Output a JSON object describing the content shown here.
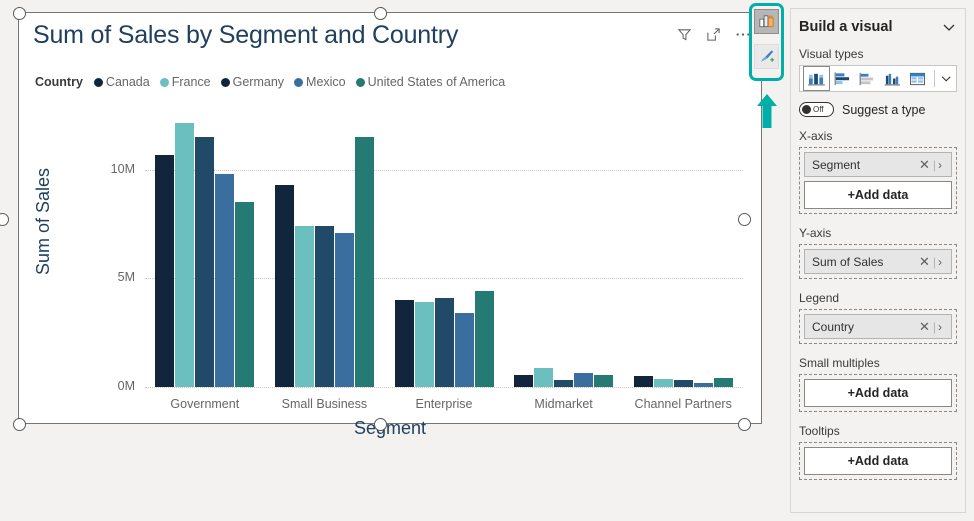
{
  "visual": {
    "title": "Sum of Sales by Segment and Country",
    "tools": {
      "filter": "filter-icon",
      "focus": "focus-mode-icon",
      "more": "more-options-icon"
    }
  },
  "chart_data": {
    "type": "bar",
    "title": "Sum of Sales by Segment and Country",
    "xlabel": "Segment",
    "ylabel": "Sum of Sales",
    "categories": [
      "Government",
      "Small Business",
      "Enterprise",
      "Midmarket",
      "Channel Partners"
    ],
    "ylim": [
      0,
      12800000
    ],
    "yticks": [
      {
        "label": "0M",
        "value": 0
      },
      {
        "label": "5M",
        "value": 5000000
      },
      {
        "label": "10M",
        "value": 10000000
      }
    ],
    "grid": true,
    "legend_title": "Country",
    "legend_position": "top",
    "series": [
      {
        "name": "Canada",
        "color": "#11263c",
        "values": [
          10700000,
          9300000,
          4000000,
          560000,
          500000
        ]
      },
      {
        "name": "France",
        "color": "#6cbfbf",
        "values": [
          12150000,
          7400000,
          3900000,
          860000,
          350000
        ]
      },
      {
        "name": "Germany",
        "color": "#214a69",
        "values": [
          11500000,
          7400000,
          4100000,
          300000,
          310000
        ]
      },
      {
        "name": "Mexico",
        "color": "#3a6e9e",
        "values": [
          9800000,
          7100000,
          3400000,
          660000,
          200000
        ]
      },
      {
        "name": "United States of America",
        "color": "#257a73",
        "values": [
          8500000,
          11500000,
          4400000,
          540000,
          420000
        ]
      }
    ]
  },
  "rail": {
    "build_button": "build-visual-icon",
    "format_button": "format-visual-icon",
    "arrow": "up-arrow-annotation",
    "highlight_color": "#00b0a8"
  },
  "pane": {
    "title": "Build a visual",
    "collapse_icon": "chevron-down-icon",
    "visual_types_label": "Visual types",
    "visual_types": [
      {
        "name": "stacked-column-chart",
        "selected": true
      },
      {
        "name": "stacked-bar-chart",
        "selected": false
      },
      {
        "name": "clustered-bar-chart",
        "selected": false
      },
      {
        "name": "clustered-column-chart",
        "selected": false
      },
      {
        "name": "table",
        "selected": false
      }
    ],
    "visual_types_more": "chevron-down-icon",
    "suggest": {
      "label": "Suggest a type",
      "state": "Off"
    },
    "wells": [
      {
        "label": "X-axis",
        "chips": [
          {
            "name": "Segment"
          }
        ],
        "add_data": "+Add data"
      },
      {
        "label": "Y-axis",
        "chips": [
          {
            "name": "Sum of Sales"
          }
        ],
        "add_data": null
      },
      {
        "label": "Legend",
        "chips": [
          {
            "name": "Country"
          }
        ],
        "add_data": null
      },
      {
        "label": "Small multiples",
        "chips": [],
        "add_data": "+Add data"
      },
      {
        "label": "Tooltips",
        "chips": [],
        "add_data": "+Add data"
      }
    ]
  }
}
